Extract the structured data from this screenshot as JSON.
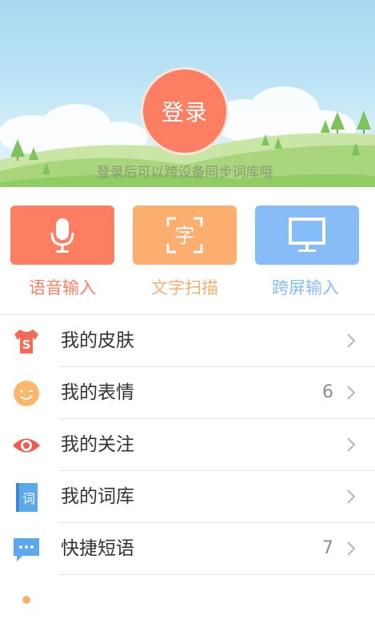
{
  "header": {
    "login_label": "登录",
    "hint": "登录后可以跨设备同步词库哦"
  },
  "actions": [
    {
      "label": "语音输入",
      "icon": "microphone-icon",
      "color": "#fd7e61"
    },
    {
      "label": "文字扫描",
      "icon": "scan-text-icon",
      "icon_text": "字",
      "color": "#fcae6f"
    },
    {
      "label": "跨屏输入",
      "icon": "monitor-icon",
      "color": "#86bdf9"
    }
  ],
  "menu": [
    {
      "label": "我的皮肤",
      "icon": "skin-shirt-icon",
      "count": ""
    },
    {
      "label": "我的表情",
      "icon": "emoji-face-icon",
      "count": "6"
    },
    {
      "label": "我的关注",
      "icon": "eye-icon",
      "count": ""
    },
    {
      "label": "我的词库",
      "icon": "dictionary-book-icon",
      "icon_text": "词",
      "count": ""
    },
    {
      "label": "快捷短语",
      "icon": "chat-bubble-icon",
      "count": "7"
    }
  ]
}
